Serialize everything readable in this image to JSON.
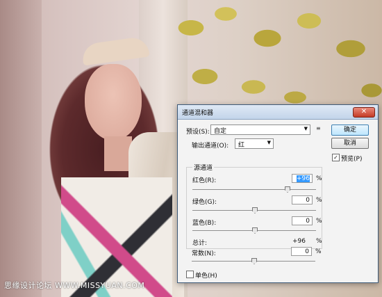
{
  "watermark": "思缘设计论坛 WWW.MISSYUAN.COM",
  "dialog": {
    "title": "通道混和器",
    "close_label": "✕",
    "preset_label": "预设(S):",
    "preset_value": "自定",
    "output_label": "输出通道(O):",
    "output_value": "红",
    "ok_label": "确定",
    "cancel_label": "取消",
    "preview_label": "预览(P)",
    "preview_checked": true,
    "source_group_label": "源通道",
    "red_label": "红色(R):",
    "red_value": "+96",
    "green_label": "绿色(G):",
    "green_value": "0",
    "blue_label": "蓝色(B):",
    "blue_value": "0",
    "total_label": "总计:",
    "total_value": "+96",
    "percent": "%",
    "constant_label": "常数(N):",
    "constant_value": "0",
    "mono_label": "单色(H)",
    "mono_checked": false
  }
}
